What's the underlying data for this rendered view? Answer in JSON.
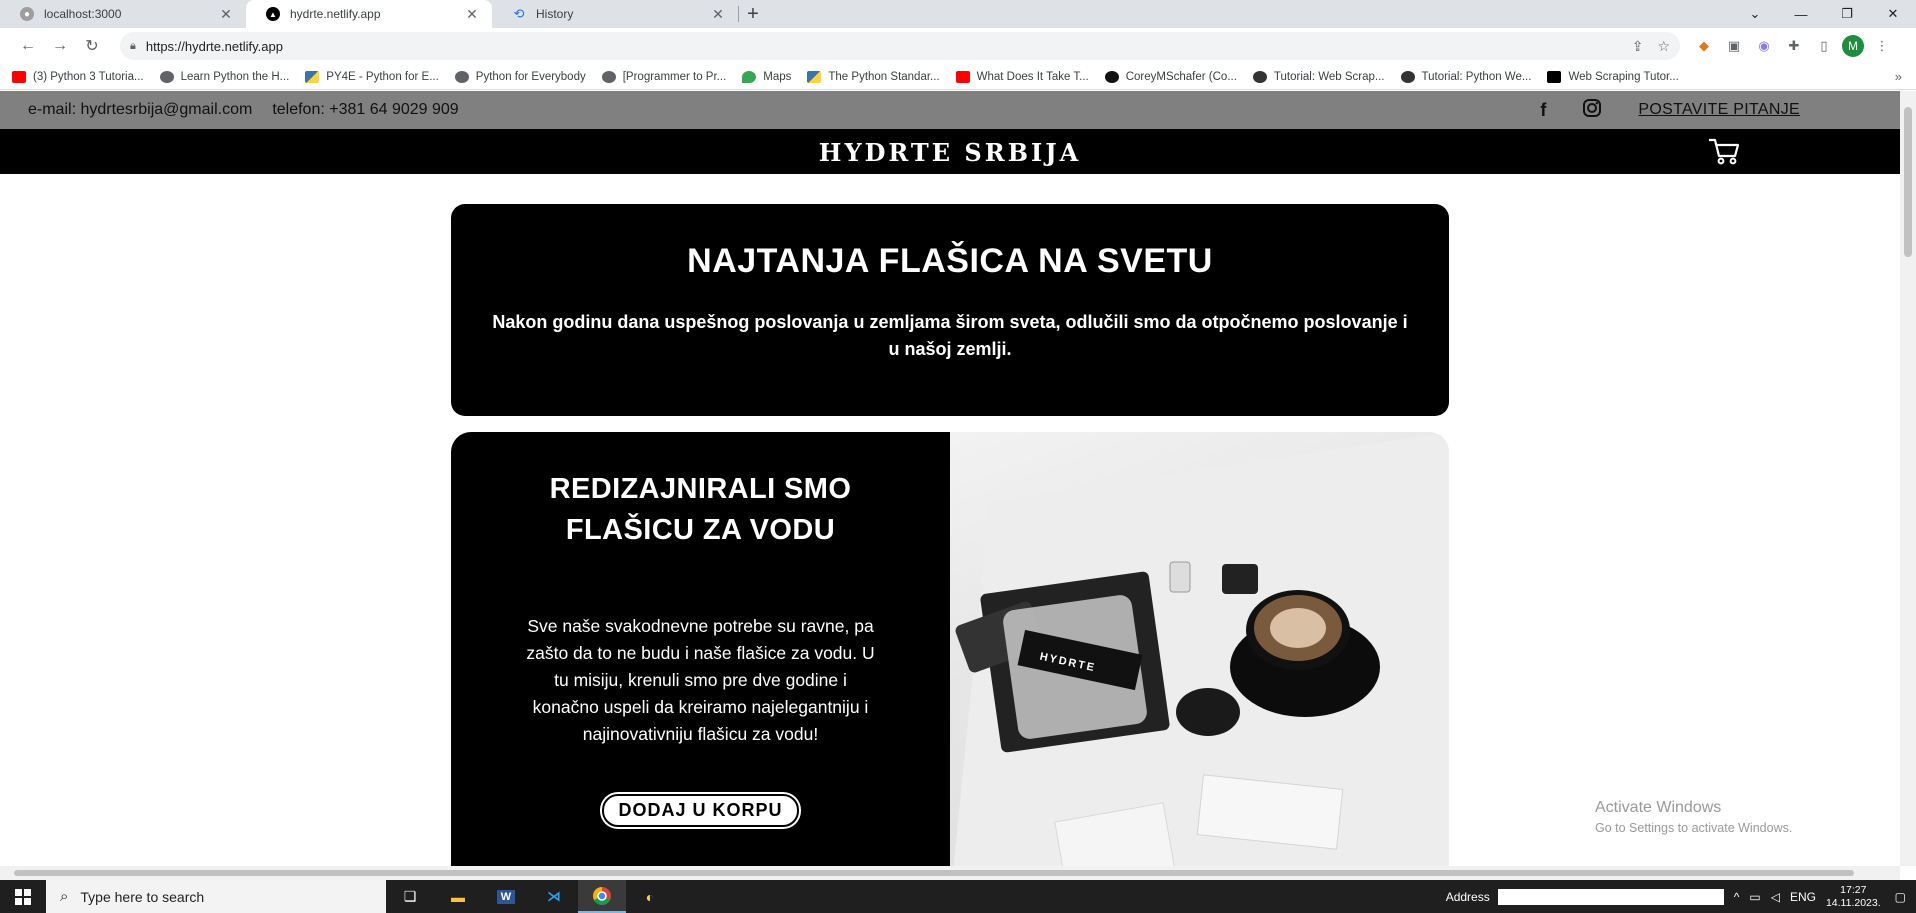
{
  "browser": {
    "tabs": [
      {
        "label": "localhost:3000",
        "favicon": "user-icon",
        "active": false
      },
      {
        "label": "hydrte.netlify.app",
        "favicon": "netlify-triangle-icon",
        "active": true
      },
      {
        "label": "History",
        "favicon": "history-icon",
        "active": false
      }
    ],
    "url": "https://hydrte.netlify.app",
    "bookmarks": [
      {
        "label": "(3) Python 3 Tutoria...",
        "icon": "youtube-icon",
        "color": "#ff0000"
      },
      {
        "label": "Learn Python the H...",
        "icon": "globe-icon",
        "color": "#5f6368"
      },
      {
        "label": "PY4E - Python for E...",
        "icon": "python-icon",
        "color": "#3776ab"
      },
      {
        "label": "Python for Everybody",
        "icon": "globe-icon",
        "color": "#5f6368"
      },
      {
        "label": "[Programmer to Pr...",
        "icon": "globe-icon",
        "color": "#5f6368"
      },
      {
        "label": "Maps",
        "icon": "maps-icon",
        "color": "#34a853"
      },
      {
        "label": "The Python Standar...",
        "icon": "python-icon",
        "color": "#3776ab"
      },
      {
        "label": "What Does It Take T...",
        "icon": "youtube-icon",
        "color": "#ff0000"
      },
      {
        "label": "CoreyMSchafer (Co...",
        "icon": "github-icon",
        "color": "#111111"
      },
      {
        "label": "Tutorial: Web Scrap...",
        "icon": "site-icon",
        "color": "#333333"
      },
      {
        "label": "Tutorial: Python We...",
        "icon": "site-icon",
        "color": "#333333"
      },
      {
        "label": "Web Scraping Tutor...",
        "icon": "medium-icon",
        "color": "#000000"
      }
    ]
  },
  "site": {
    "contact": {
      "email": "e-mail: hydrtesrbija@gmail.com",
      "phone": "telefon: +381 64 9029 909",
      "ask_label": "POSTAVITE PITANJE"
    },
    "brand": "HYDRTE SRBIJA",
    "hero1": {
      "title": "NAJTANJA FLAŠICA NA SVETU",
      "text": "Nakon godinu dana uspešnog poslovanja u zemljama širom sveta, odlučili smo da otpočnemo poslovanje i u našoj zemlji."
    },
    "hero2": {
      "title": "REDIZAJNIRALI SMO FLAŠICU ZA VODU",
      "text": "Sve naše svakodnevne potrebe su ravne, pa zašto da to ne budu i naše flašice za vodu. U tu misiju, krenuli smo pre dve godine i konačno uspeli da kreiramo najelegantniju i najinovativniju flašicu za vodu!",
      "button": "DODAJ U KORPU",
      "image_alt": "HYDRTE"
    }
  },
  "os": {
    "activate_title": "Activate Windows",
    "activate_sub": "Go to Settings to activate Windows.",
    "search_placeholder": "Type here to search",
    "address_label": "Address",
    "lang": "ENG",
    "time": "17:27",
    "date": "14.11.2023."
  }
}
